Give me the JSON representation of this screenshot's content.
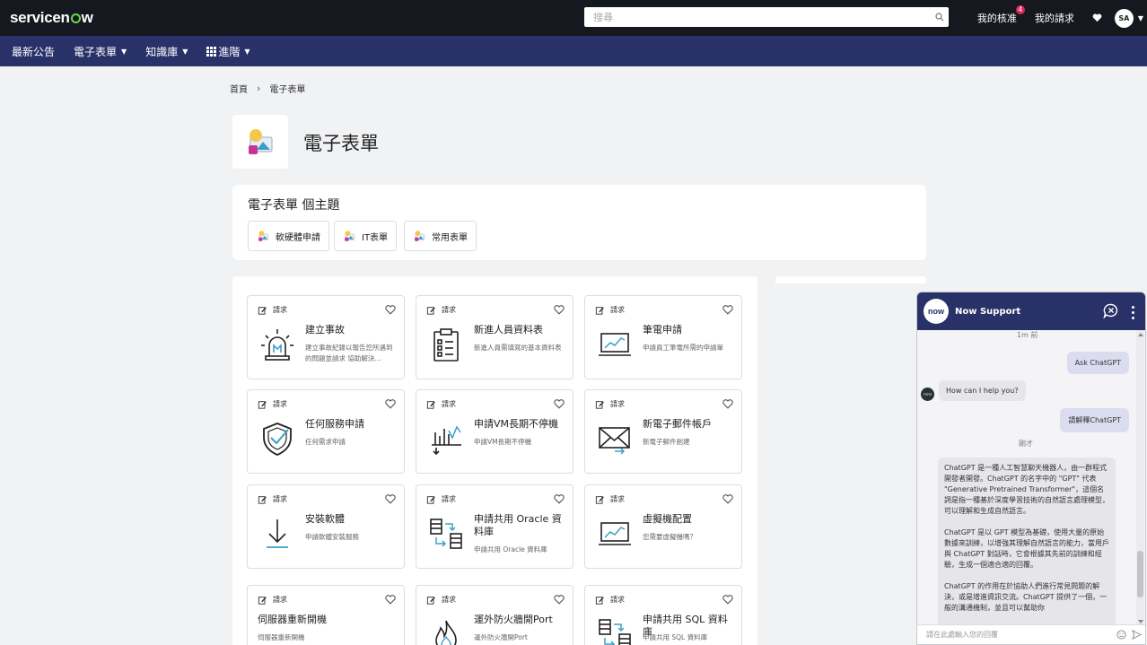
{
  "topbar": {
    "logo_pre": "servicen",
    "logo_post": "w",
    "search_placeholder": "搜尋",
    "approvals_label": "我的核准",
    "approvals_count": "4",
    "requests_label": "我的請求",
    "avatar_initials": "SA"
  },
  "nav": {
    "items": [
      "最新公告",
      "電子表單",
      "知識庫",
      "進階"
    ]
  },
  "breadcrumb": {
    "home": "首頁",
    "current": "電子表單"
  },
  "page": {
    "title": "電子表單"
  },
  "topics": {
    "title": "電子表單 個主題",
    "chips": [
      "軟硬體申請",
      "IT表單",
      "常用表單"
    ]
  },
  "catalog": {
    "request_label": "請求",
    "cards": [
      {
        "title": "建立事故",
        "desc": "建立事故紀錄以報告您所遇到的問題並請求 協助解決..."
      },
      {
        "title": "新進人員資料表",
        "desc": "新進人員需填寫的基本資料表"
      },
      {
        "title": "筆電申請",
        "desc": "申請員工筆電所需的申請單"
      },
      {
        "title": "任何服務申請",
        "desc": "任何需求申請"
      },
      {
        "title": "申請VM長期不停機",
        "desc": "申請VM長期不停機"
      },
      {
        "title": "新電子郵件帳戶",
        "desc": "新電子郵件創建"
      },
      {
        "title": "安裝軟體",
        "desc": "申請軟體安裝服務"
      },
      {
        "title": "申請共用 Oracle 資料庫",
        "desc": "申請共用 Oracle 資料庫"
      },
      {
        "title": "虛擬機配置",
        "desc": "您需要虛擬機嗎？"
      },
      {
        "title": "伺服器重新開機",
        "desc": "伺服器重新開機"
      },
      {
        "title": "運外防火牆開Port",
        "desc": "運外防火牆開Port"
      },
      {
        "title": "申請共用 SQL 資料庫",
        "desc": "申請共用 SQL 資料庫"
      }
    ]
  },
  "chat": {
    "title": "Now Support",
    "logo_text": "now",
    "time1": "1m 前",
    "msg_user1": "Ask ChatGPT",
    "msg_bot1": "How can I help you?",
    "msg_user2": "請解釋ChatGPT",
    "time2": "剛才",
    "long_p1": "ChatGPT 是一種人工智慧聊天機器人，由一群程式開發者開發。ChatGPT 的名字中的 \"GPT\" 代表 \"Generative Pretrained Transformer\"，這個名詞是指一種基於深度學習技術的自然語言處理模型，可以理解和生成自然語言。",
    "long_p2": "ChatGPT 是以 GPT 模型為基礎，使用大量的原始數據來訓練，以增強其理解自然語言的能力，當用戶與 ChatGPT 對話時，它會根據其先前的訓練和經驗，生成一個適合適的回覆。",
    "long_p3": "ChatGPT 的作用在於協助人們進行常見問題的解決，或是增進資訊交流。ChatGPT 提供了一個，一般的溝通機制，並且可以幫助你",
    "input_placeholder": "請在此處輸入您的回覆"
  },
  "colors": {
    "topbar": "#16181f",
    "navbar": "#283168",
    "logo_accent": "#62d84e",
    "badge": "#e0245e"
  }
}
